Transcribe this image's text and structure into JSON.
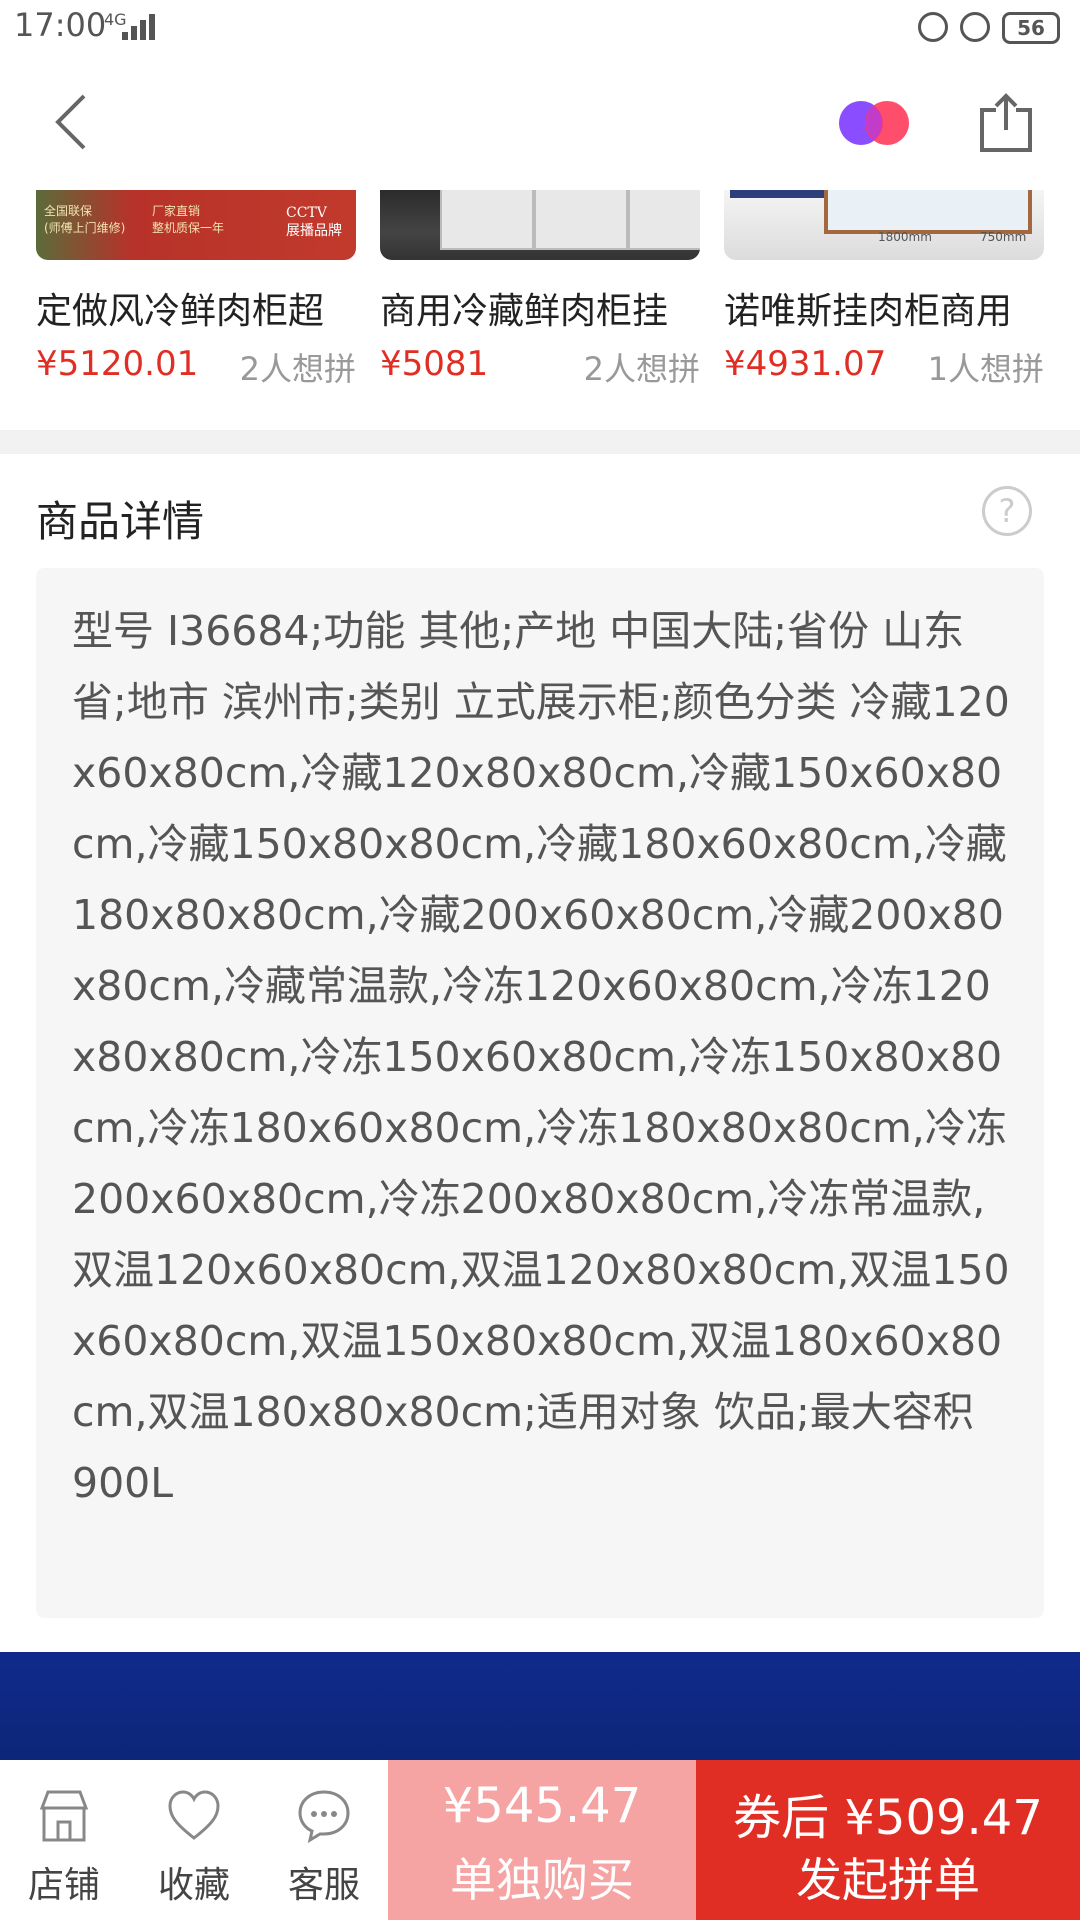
{
  "status_bar": {
    "time": "17:00",
    "network": "4G",
    "battery": "56"
  },
  "recommendations": [
    {
      "title": "定做风冷鲜肉柜超",
      "price": "¥5120.01",
      "interest": "2人想拼",
      "thumb_texts": [
        "全国联保\n(师傅上门维修)",
        "厂家直销\n整机质保一年",
        "CCTV\n展播品牌"
      ]
    },
    {
      "title": "商用冷藏鲜肉柜挂",
      "price": "¥5081",
      "interest": "2人想拼"
    },
    {
      "title": "诺唯斯挂肉柜商用",
      "price": "¥4931.07",
      "interest": "1人想拼",
      "thumb_texts": [
        "1800mm",
        "750mm"
      ]
    }
  ],
  "details": {
    "title": "商品详情",
    "help": "?",
    "text": "型号 I36684;功能 其他;产地 中国大陆;省份 山东省;地市 滨州市;类别 立式展示柜;颜色分类 冷藏120x60x80cm,冷藏120x80x80cm,冷藏150x60x80cm,冷藏150x80x80cm,冷藏180x60x80cm,冷藏180x80x80cm,冷藏200x60x80cm,冷藏200x80x80cm,冷藏常温款,冷冻120x60x80cm,冷冻120x80x80cm,冷冻150x60x80cm,冷冻150x80x80cm,冷冻180x60x80cm,冷冻180x80x80cm,冷冻200x60x80cm,冷冻200x80x80cm,冷冻常温款,双温120x60x80cm,双温120x80x80cm,双温150x60x80cm,双温150x80x80cm,双温180x60x80cm,双温180x80x80cm;适用对象 饮品;最大容积 900L"
  },
  "bottom_bar": {
    "store": "店铺",
    "favorite": "收藏",
    "service": "客服",
    "single_price": "¥545.47",
    "single_label": "单独购买",
    "group_price": "券后 ¥509.47",
    "group_label": "发起拼单"
  },
  "colors": {
    "accent": "#e02e24",
    "single_button": "#f5a4a3",
    "banner": "#102a8c"
  }
}
